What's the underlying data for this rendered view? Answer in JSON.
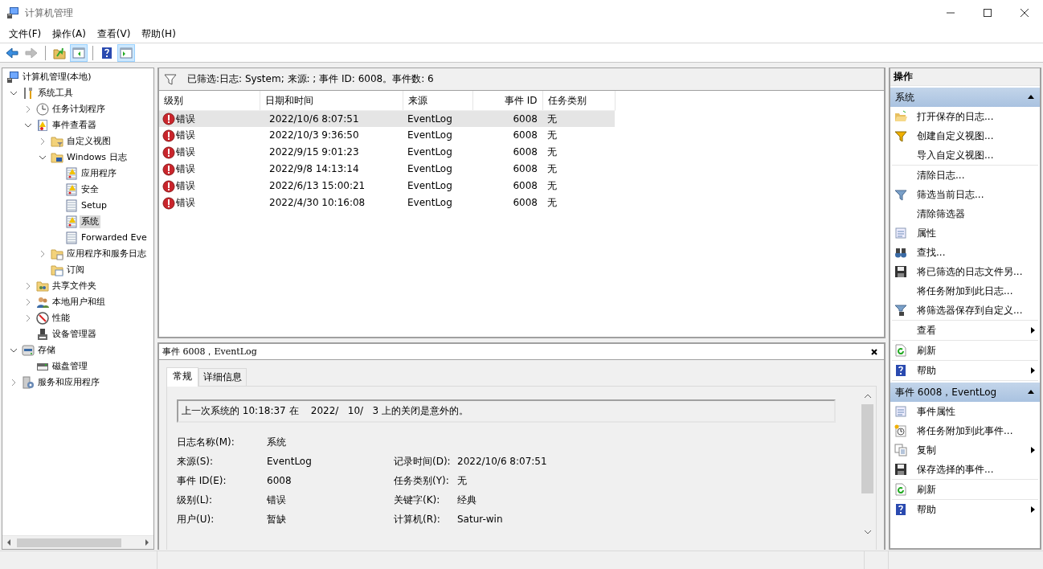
{
  "window": {
    "title": "计算机管理"
  },
  "menu": [
    "文件(F)",
    "操作(A)",
    "查看(V)",
    "帮助(H)"
  ],
  "toolbar": [
    {
      "kind": "back",
      "disabled": false,
      "pressed": false
    },
    {
      "kind": "forward",
      "disabled": true,
      "pressed": false
    },
    {
      "kind": "separator"
    },
    {
      "kind": "up",
      "disabled": false,
      "pressed": false
    },
    {
      "kind": "tree-toggle",
      "disabled": false,
      "pressed": true
    },
    {
      "kind": "separator"
    },
    {
      "kind": "help",
      "disabled": false,
      "pressed": false
    },
    {
      "kind": "action-toggle",
      "disabled": false,
      "pressed": true
    }
  ],
  "tree": [
    {
      "label": "计算机管理(本地)",
      "kind": "computer",
      "selected": false,
      "children": [
        {
          "label": "系统工具",
          "kind": "tools",
          "expandable": true,
          "expanded": true,
          "selected": false,
          "children": [
            {
              "label": "任务计划程序",
              "kind": "clock",
              "expandable": true,
              "expanded": false,
              "selected": false
            },
            {
              "label": "事件查看器",
              "kind": "eventviewer",
              "expandable": true,
              "expanded": true,
              "selected": false,
              "children": [
                {
                  "label": "自定义视图",
                  "kind": "folder-filter",
                  "expandable": true,
                  "expanded": false,
                  "selected": false
                },
                {
                  "label": "Windows 日志",
                  "kind": "folder-computer",
                  "expandable": true,
                  "expanded": true,
                  "selected": false,
                  "children": [
                    {
                      "label": "应用程序",
                      "kind": "log-warn",
                      "selected": false
                    },
                    {
                      "label": "安全",
                      "kind": "log-warn",
                      "selected": false
                    },
                    {
                      "label": "Setup",
                      "kind": "log",
                      "selected": false
                    },
                    {
                      "label": "系统",
                      "kind": "log-warn",
                      "selected": true
                    },
                    {
                      "label": "Forwarded Eve",
                      "kind": "log",
                      "selected": false
                    }
                  ]
                },
                {
                  "label": "应用程序和服务日志",
                  "kind": "folder",
                  "expandable": true,
                  "expanded": false,
                  "selected": false
                },
                {
                  "label": "订阅",
                  "kind": "folder-sub",
                  "selected": false
                }
              ]
            },
            {
              "label": "共享文件夹",
              "kind": "share",
              "expandable": true,
              "expanded": false,
              "selected": false
            },
            {
              "label": "本地用户和组",
              "kind": "users",
              "expandable": true,
              "expanded": false,
              "selected": false
            },
            {
              "label": "性能",
              "kind": "perf",
              "expandable": true,
              "expanded": false,
              "selected": false
            },
            {
              "label": "设备管理器",
              "kind": "device",
              "selected": false
            }
          ]
        },
        {
          "label": "存储",
          "kind": "storage",
          "expandable": true,
          "expanded": true,
          "selected": false,
          "children": [
            {
              "label": "磁盘管理",
              "kind": "disk",
              "selected": false
            }
          ]
        },
        {
          "label": "服务和应用程序",
          "kind": "services",
          "expandable": true,
          "expanded": false,
          "selected": false
        }
      ]
    }
  ],
  "filter_bar": {
    "text": "已筛选:日志: System; 来源: ; 事件 ID: 6008。事件数: 6"
  },
  "table": {
    "columns": [
      "级别",
      "日期和时间",
      "来源",
      "事件 ID",
      "任务类别"
    ],
    "rows": [
      {
        "level": "错误",
        "date": "2022/10/6 8:07:51",
        "source": "EventLog",
        "id": "6008",
        "category": "无",
        "selected": true
      },
      {
        "level": "错误",
        "date": "2022/10/3 9:36:50",
        "source": "EventLog",
        "id": "6008",
        "category": "无",
        "selected": false
      },
      {
        "level": "错误",
        "date": "2022/9/15 9:01:23",
        "source": "EventLog",
        "id": "6008",
        "category": "无",
        "selected": false
      },
      {
        "level": "错误",
        "date": "2022/9/8 14:13:14",
        "source": "EventLog",
        "id": "6008",
        "category": "无",
        "selected": false
      },
      {
        "level": "错误",
        "date": "2022/6/13 15:00:21",
        "source": "EventLog",
        "id": "6008",
        "category": "无",
        "selected": false
      },
      {
        "level": "错误",
        "date": "2022/4/30 10:16:08",
        "source": "EventLog",
        "id": "6008",
        "category": "无",
        "selected": false
      }
    ]
  },
  "detail": {
    "title": "事件 6008，EventLog",
    "tabs": [
      {
        "label": "常规",
        "selected": true
      },
      {
        "label": "详细信息",
        "selected": false
      }
    ],
    "message": "上一次系统的 10:18:37 在    2022/   10/   3 上的关闭是意外的。",
    "rows": [
      [
        {
          "label": "日志名称(M):",
          "value": "系统"
        }
      ],
      [
        {
          "label": "来源(S):",
          "value": "EventLog"
        },
        {
          "label": "记录时间(D):",
          "value": "2022/10/6 8:07:51"
        }
      ],
      [
        {
          "label": "事件 ID(E):",
          "value": "6008"
        },
        {
          "label": "任务类别(Y):",
          "value": "无"
        }
      ],
      [
        {
          "label": "级别(L):",
          "value": "错误"
        },
        {
          "label": "关键字(K):",
          "value": "经典"
        }
      ],
      [
        {
          "label": "用户(U):",
          "value": "暂缺"
        },
        {
          "label": "计算机(R):",
          "value": "Satur-win"
        }
      ]
    ]
  },
  "actions": {
    "title": "操作",
    "sections": [
      {
        "title": "系统",
        "collapsed": false,
        "groups": [
          [
            {
              "label": "打开保存的日志...",
              "kind": "folder-open",
              "submenu": false
            },
            {
              "label": "创建自定义视图...",
              "kind": "filter-new",
              "submenu": false
            },
            {
              "label": "导入自定义视图...",
              "kind": "none",
              "submenu": false
            }
          ],
          [
            {
              "label": "清除日志...",
              "kind": "none",
              "submenu": false
            },
            {
              "label": "筛选当前日志...",
              "kind": "filter",
              "submenu": false
            },
            {
              "label": "清除筛选器",
              "kind": "none",
              "submenu": false
            },
            {
              "label": "属性",
              "kind": "properties",
              "submenu": false
            },
            {
              "label": "查找...",
              "kind": "binoculars",
              "submenu": false
            },
            {
              "label": "将已筛选的日志文件另...",
              "kind": "floppy",
              "submenu": false
            },
            {
              "label": "将任务附加到此日志...",
              "kind": "none",
              "submenu": false
            },
            {
              "label": "将筛选器保存到自定义...",
              "kind": "filter-save",
              "submenu": false
            }
          ],
          [
            {
              "label": "查看",
              "kind": "none",
              "submenu": true
            }
          ],
          [
            {
              "label": "刷新",
              "kind": "refresh",
              "submenu": false
            }
          ],
          [
            {
              "label": "帮助",
              "kind": "help",
              "submenu": true
            }
          ]
        ]
      },
      {
        "title": "事件 6008，EventLog",
        "collapsed": false,
        "groups": [
          [
            {
              "label": "事件属性",
              "kind": "properties",
              "submenu": false
            },
            {
              "label": "将任务附加到此事件...",
              "kind": "task",
              "submenu": false
            },
            {
              "label": "复制",
              "kind": "copy",
              "submenu": true
            },
            {
              "label": "保存选择的事件...",
              "kind": "floppy",
              "submenu": false
            }
          ],
          [
            {
              "label": "刷新",
              "kind": "refresh",
              "submenu": false
            }
          ],
          [
            {
              "label": "帮助",
              "kind": "help",
              "submenu": true
            }
          ]
        ]
      }
    ]
  }
}
